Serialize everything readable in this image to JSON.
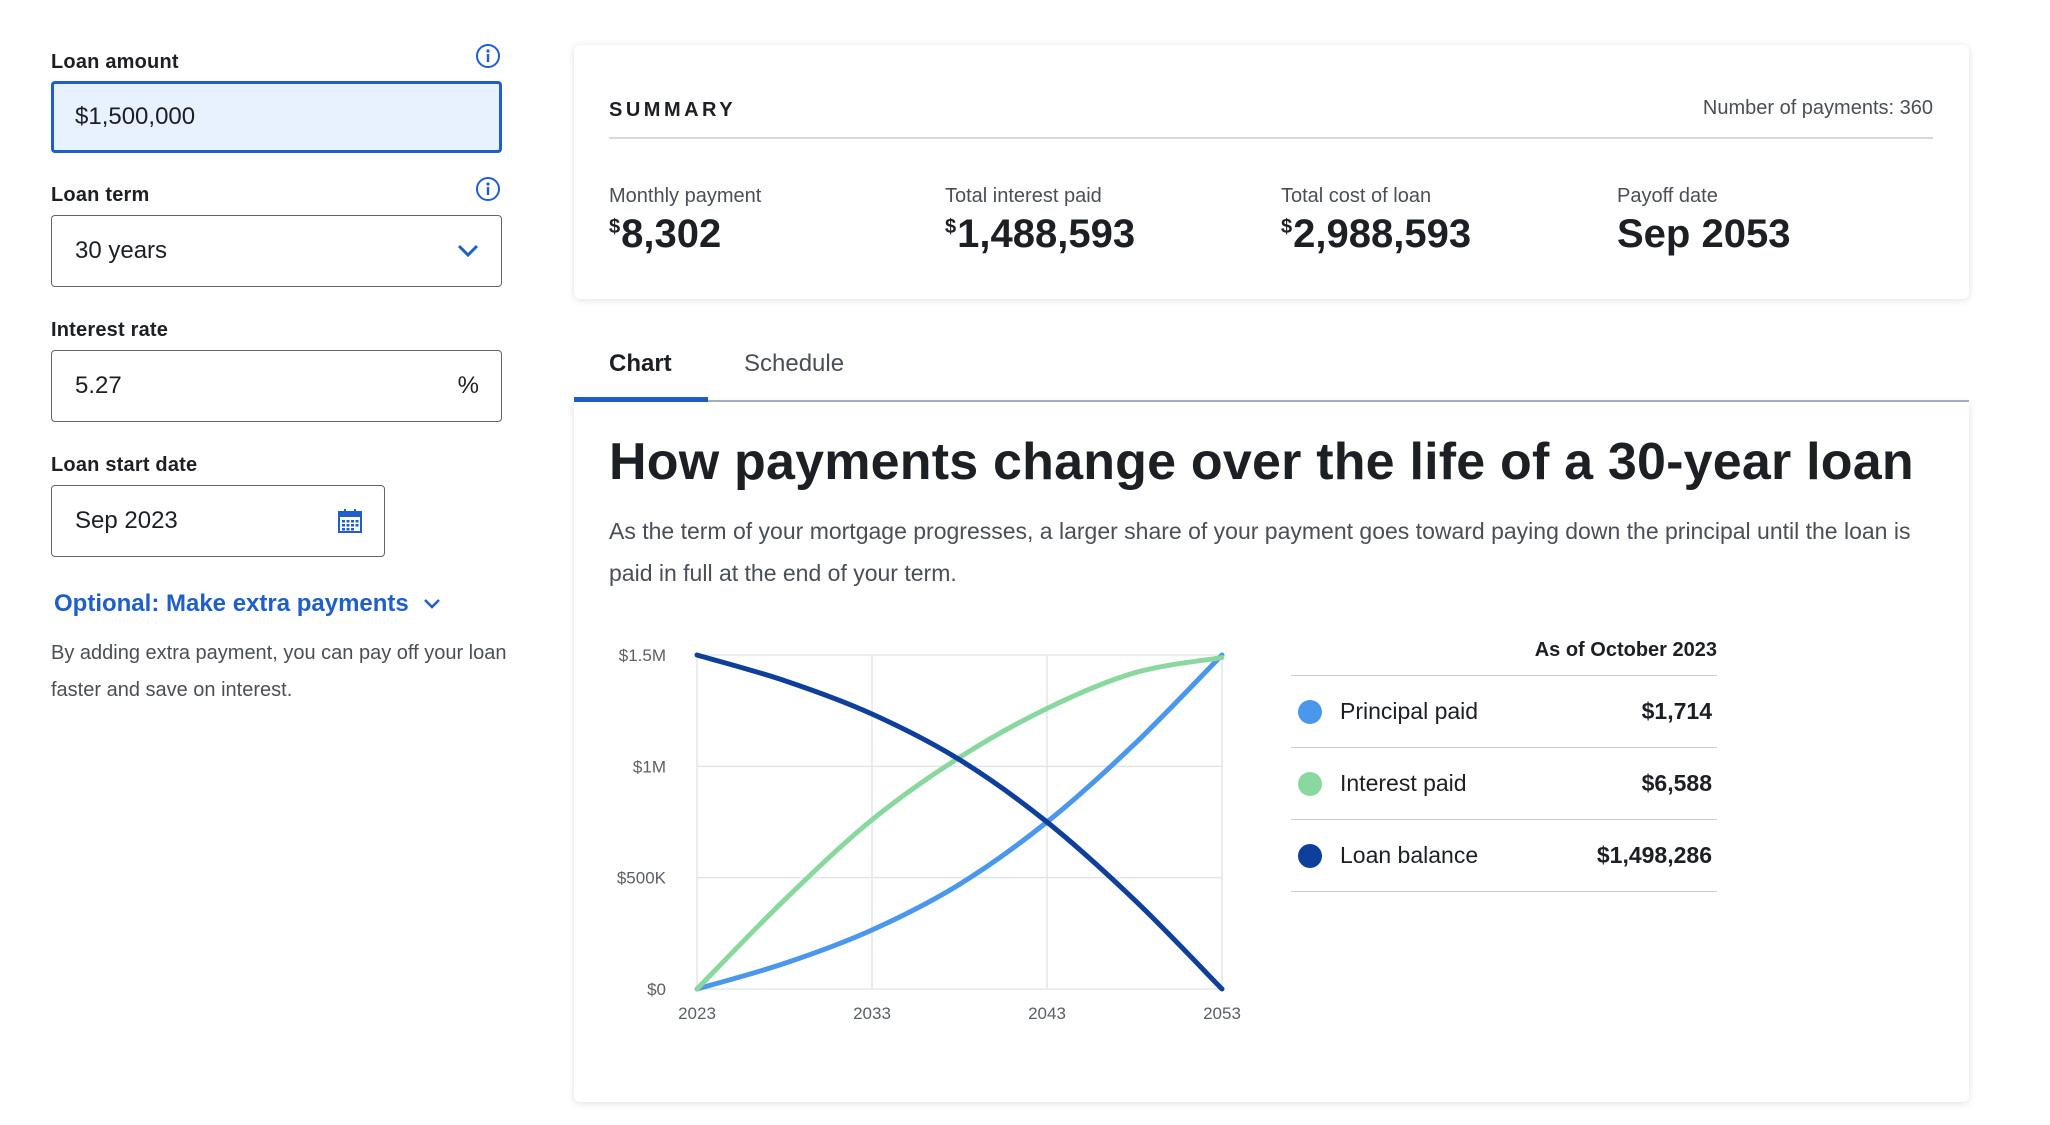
{
  "form": {
    "loan_amount": {
      "label": "Loan amount",
      "value": "$1,500,000"
    },
    "loan_term": {
      "label": "Loan term",
      "value": "30 years"
    },
    "interest_rate": {
      "label": "Interest rate",
      "value": "5.27",
      "suffix": "%"
    },
    "loan_start_date": {
      "label": "Loan start date",
      "value": "Sep 2023"
    },
    "extra_payments": {
      "link_label": "Optional: Make extra payments",
      "description": "By adding extra payment, you can pay off your loan faster and save on interest."
    }
  },
  "summary": {
    "title": "SUMMARY",
    "payments_count": "Number of payments: 360",
    "stats": [
      {
        "label": "Monthly payment",
        "currency": "$",
        "value": "8,302"
      },
      {
        "label": "Total interest paid",
        "currency": "$",
        "value": "1,488,593"
      },
      {
        "label": "Total cost of loan",
        "currency": "$",
        "value": "2,988,593"
      },
      {
        "label": "Payoff date",
        "currency": "",
        "value": "Sep 2053"
      }
    ]
  },
  "tabs": [
    {
      "label": "Chart",
      "active": true
    },
    {
      "label": "Schedule",
      "active": false
    }
  ],
  "chart_section": {
    "heading": "How payments change over the life of a 30-year loan",
    "description": "As the term of your mortgage progresses, a larger share of your payment goes toward paying down the principal until the loan is paid in full at the end of your term."
  },
  "legend": {
    "as_of": "As of October 2023",
    "rows": [
      {
        "name": "Principal paid",
        "amount": "$1,714",
        "color": "#4a97ec"
      },
      {
        "name": "Interest paid",
        "amount": "$6,588",
        "color": "#8ad89f"
      },
      {
        "name": "Loan balance",
        "amount": "$1,498,286",
        "color": "#0d3f9b"
      }
    ]
  },
  "colors": {
    "accent": "#1f5fc8",
    "principal": "#4a97ec",
    "interest": "#8ad89f",
    "balance": "#0d3f9b"
  },
  "chart_data": {
    "type": "line",
    "x": [
      2023,
      2028,
      2033,
      2038,
      2043,
      2048,
      2053
    ],
    "xticks": [
      "2023",
      "2033",
      "2043",
      "2053"
    ],
    "yticks": [
      "$0",
      "$500K",
      "$1M",
      "$1.5M"
    ],
    "ylim": [
      0,
      1500000
    ],
    "xlim": [
      2023,
      2053
    ],
    "grid": true,
    "series": [
      {
        "name": "Principal paid",
        "color": "#4a97ec",
        "values": [
          0,
          115000,
          265000,
          470000,
          750000,
          1100000,
          1500000
        ]
      },
      {
        "name": "Interest paid",
        "color": "#8ad89f",
        "values": [
          0,
          400000,
          760000,
          1040000,
          1260000,
          1420000,
          1488593
        ]
      },
      {
        "name": "Loan balance",
        "color": "#0d3f9b",
        "values": [
          1500000,
          1385000,
          1235000,
          1030000,
          750000,
          400000,
          0
        ]
      }
    ]
  }
}
